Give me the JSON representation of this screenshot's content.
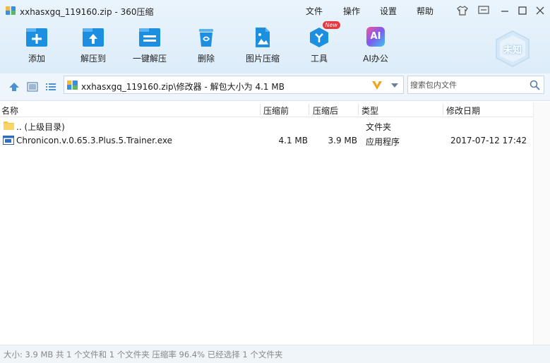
{
  "window": {
    "title": "xxhasxgq_119160.zip - 360压缩",
    "menus": [
      "文件",
      "操作",
      "设置",
      "帮助"
    ]
  },
  "toolbar": {
    "items": [
      {
        "label": "添加",
        "icon": "add-archive-icon"
      },
      {
        "label": "解压到",
        "icon": "extract-to-icon"
      },
      {
        "label": "一键解压",
        "icon": "one-click-extract-icon"
      },
      {
        "label": "删除",
        "icon": "delete-icon"
      },
      {
        "label": "图片压缩",
        "icon": "image-compress-icon"
      },
      {
        "label": "工具",
        "icon": "tools-icon",
        "badge": "New"
      },
      {
        "label": "AI办公",
        "icon": "ai-office-icon",
        "icon_text": "AI"
      }
    ],
    "avatar_label": "未知"
  },
  "address": {
    "path": "xxhasxgq_119160.zip\\修改器 - 解包大小为 4.1 MB",
    "search_placeholder": "搜索包内文件"
  },
  "columns": {
    "name": "名称",
    "compressed_before": "压缩前",
    "compressed_after": "压缩后",
    "type": "类型",
    "modified": "修改日期"
  },
  "files": [
    {
      "name": ".. (上级目录)",
      "before": "",
      "after": "",
      "type": "文件夹",
      "modified": "",
      "icon": "folder-icon"
    },
    {
      "name": "Chronicon.v.0.65.3.Plus.5.Trainer.exe",
      "before": "4.1 MB",
      "after": "3.9 MB",
      "type": "应用程序",
      "modified": "2017-07-12 17:42",
      "icon": "exe-file-icon"
    }
  ],
  "status": {
    "text": "大小: 3.9 MB 共 1 个文件和 1 个文件夹 压缩率 96.4% 已经选择 1 个文件夹"
  },
  "colors": {
    "accent_blue": "#1d8fe1",
    "top_background": "#e3effa",
    "ai_pink": "#e84c8b",
    "new_badge": "#e8383d",
    "folder_yellow": "#f6c543"
  }
}
